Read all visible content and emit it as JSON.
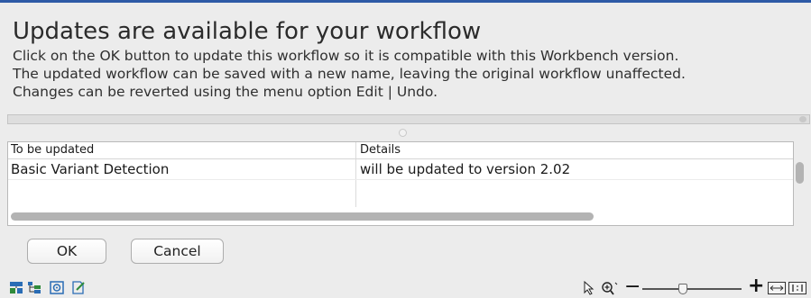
{
  "dialog": {
    "title": "Updates are available for your workflow",
    "description": [
      "Click on the OK button to update this workflow so it is compatible with this Workbench version.",
      "The updated workflow can be saved with a new name, leaving the original workflow unaffected.",
      "Changes can be reverted using the menu option Edit | Undo."
    ]
  },
  "table": {
    "columns": [
      "To be updated",
      "Details"
    ],
    "rows": [
      {
        "name": "Basic Variant Detection",
        "details": "will be updated to version 2.02"
      }
    ]
  },
  "buttons": {
    "ok": "OK",
    "cancel": "Cancel"
  },
  "toolbar": {
    "left_icons": [
      "workflow-layout-icon",
      "workflow-tree-icon",
      "target-icon",
      "edit-document-icon"
    ],
    "right_icons": [
      "pointer-icon",
      "zoom-icon",
      "zoom-out-icon",
      "zoom-in-icon",
      "fit-width-icon",
      "actual-size-icon"
    ],
    "zoom_slider_level": 0.4
  },
  "colors": {
    "accent_border": "#2e5aa6",
    "icon_blue": "#2a6db5",
    "icon_green": "#2f8a3a"
  }
}
